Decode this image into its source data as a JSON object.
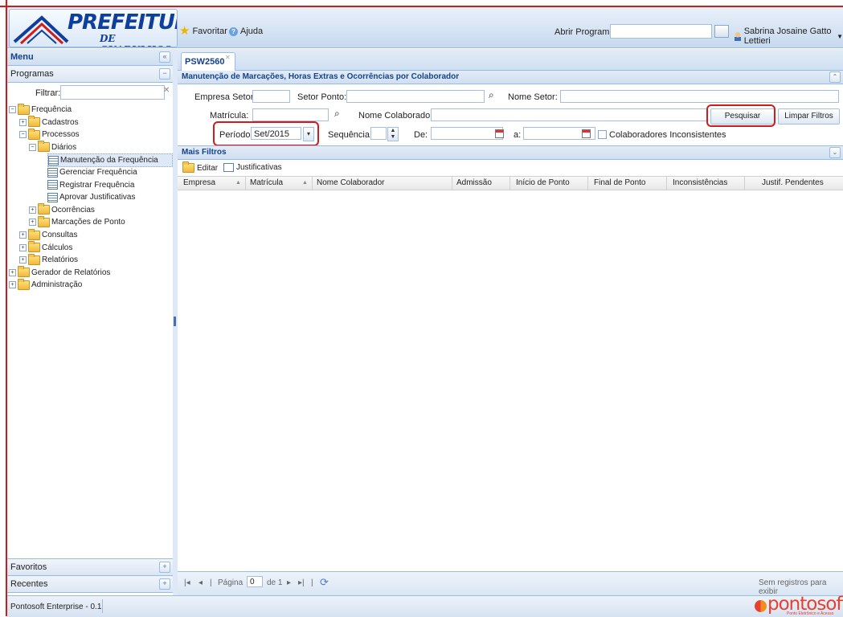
{
  "header": {
    "logo_main": "PREFEITURA",
    "logo_sub": "DE GUARULHOS",
    "favoritar": "Favoritar",
    "ajuda": "Ajuda",
    "abrir_programa_label": "Abrir Programa:",
    "abrir_programa_value": "",
    "user_name": "Sabrina Josaine Gatto Lettieri"
  },
  "sidebar": {
    "menu_title": "Menu",
    "programas_title": "Programas",
    "filtrar_label": "Filtrar:",
    "filtrar_value": "",
    "tree": [
      {
        "label": "Frequência",
        "level": 0,
        "type": "folder",
        "expanded": true
      },
      {
        "label": "Cadastros",
        "level": 1,
        "type": "folder",
        "expanded": false
      },
      {
        "label": "Processos",
        "level": 1,
        "type": "folder",
        "expanded": true
      },
      {
        "label": "Diários",
        "level": 2,
        "type": "folder",
        "expanded": true
      },
      {
        "label": "Manutenção da Frequência",
        "level": 3,
        "type": "item",
        "selected": true
      },
      {
        "label": "Gerenciar Frequência",
        "level": 3,
        "type": "item"
      },
      {
        "label": "Registrar Frequência",
        "level": 3,
        "type": "item"
      },
      {
        "label": "Aprovar Justificativas",
        "level": 3,
        "type": "item"
      },
      {
        "label": "Ocorrências",
        "level": 2,
        "type": "folder",
        "expanded": false
      },
      {
        "label": "Marcações de Ponto",
        "level": 2,
        "type": "folder",
        "expanded": false
      },
      {
        "label": "Consultas",
        "level": 1,
        "type": "folder",
        "expanded": false
      },
      {
        "label": "Cálculos",
        "level": 1,
        "type": "folder",
        "expanded": false
      },
      {
        "label": "Relatórios",
        "level": 1,
        "type": "folder",
        "expanded": false
      },
      {
        "label": "Gerador de Relatórios",
        "level": 0,
        "type": "folder",
        "expanded": false
      },
      {
        "label": "Administração",
        "level": 0,
        "type": "folder",
        "expanded": false
      }
    ],
    "favoritos_title": "Favoritos",
    "recentes_title": "Recentes"
  },
  "main": {
    "tab_label": "PSW2560",
    "section_title": "Manutenção de Marcações, Horas Extras e Ocorrências por Colaborador",
    "form": {
      "empresa_setor_label": "Empresa Setor:",
      "empresa_setor_value": "",
      "setor_ponto_label": "Setor Ponto:",
      "setor_ponto_value": "",
      "nome_setor_label": "Nome Setor:",
      "nome_setor_value": "",
      "matricula_label": "Matrícula:",
      "matricula_value": "",
      "nome_colaborador_label": "Nome Colaborador:",
      "nome_colaborador_value": "",
      "periodo_label": "Período:",
      "periodo_value": "Set/2015",
      "sequencia_label": "Sequência:",
      "sequencia_value": "",
      "de_label": "De:",
      "de_value": "",
      "a_label": "a:",
      "a_value": "",
      "colaboradores_inconsistentes_label": "Colaboradores Inconsistentes",
      "pesquisar_label": "Pesquisar",
      "limpar_filtros_label": "Limpar Filtros"
    },
    "mais_filtros_title": "Mais Filtros",
    "toolbar": {
      "editar_label": "Editar",
      "justificativas_label": "Justificativas"
    },
    "grid_columns": [
      "Empresa",
      "Matrícula",
      "Nome Colaborador",
      "Admissão",
      "Início de Ponto",
      "Final de Ponto",
      "Inconsistências",
      "Justif. Pendentes"
    ],
    "pager": {
      "pagina_label": "Página",
      "page_value": "0",
      "de_total": "de 1",
      "empty_message": "Sem registros para exibir"
    }
  },
  "statusbar": {
    "text": "Pontosoft Enterprise - 0.1",
    "brand": "pontosoft",
    "brand_sub": "Ponto Eletrônico e Acesso"
  },
  "colors": {
    "accent_blue": "#15428b",
    "highlight_red": "#d21b1b",
    "panel_border": "#99bbe8"
  }
}
